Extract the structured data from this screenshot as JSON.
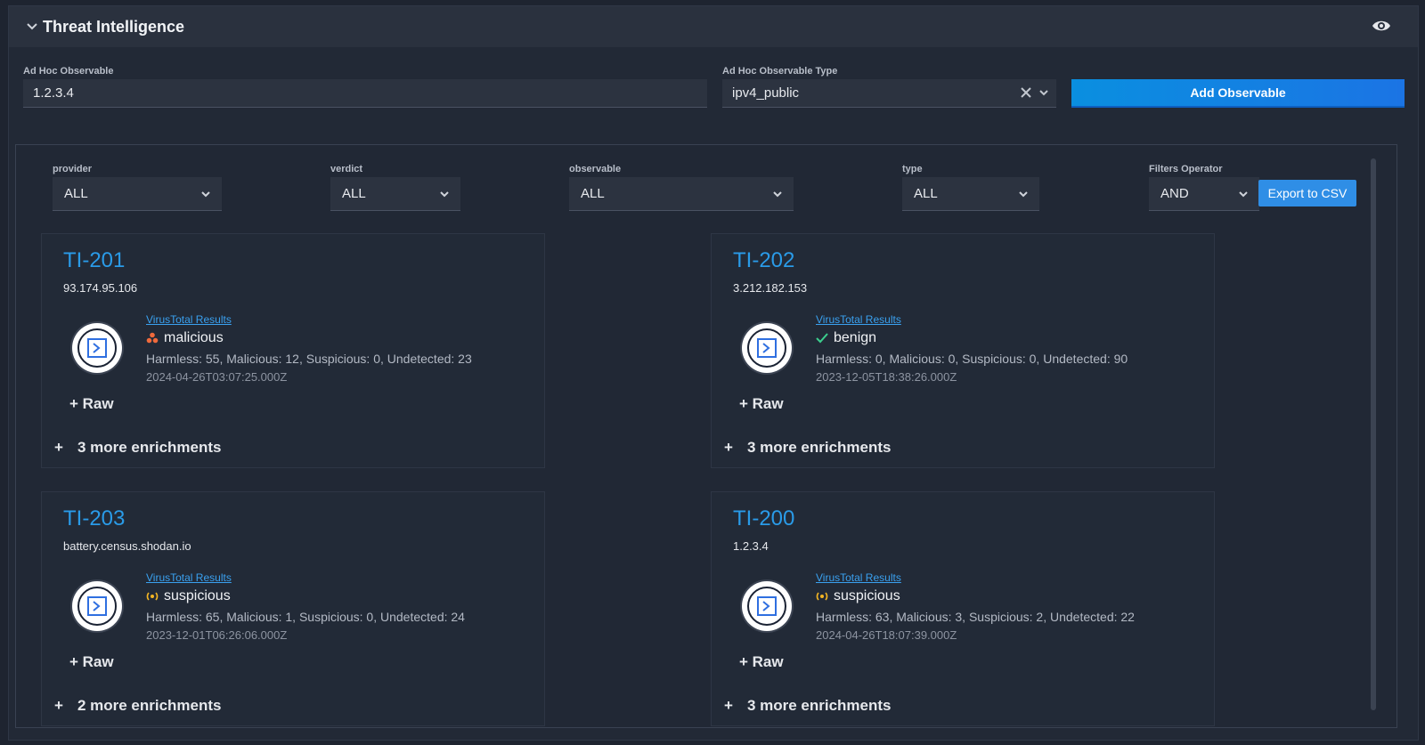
{
  "panel": {
    "title": "Threat Intelligence",
    "icons": {
      "collapse": "chevron-down-icon",
      "visibility": "eye-icon"
    }
  },
  "adhoc": {
    "observable_label": "Ad Hoc Observable",
    "observable_value": "1.2.3.4",
    "type_label": "Ad Hoc Observable Type",
    "type_value": "ipv4_public",
    "add_button": "Add Observable"
  },
  "filters": {
    "provider": {
      "label": "provider",
      "value": "ALL"
    },
    "verdict": {
      "label": "verdict",
      "value": "ALL"
    },
    "observable": {
      "label": "observable",
      "value": "ALL"
    },
    "type": {
      "label": "type",
      "value": "ALL"
    },
    "operator": {
      "label": "Filters Operator",
      "value": "AND"
    },
    "export_button": "Export to CSV"
  },
  "cards": [
    {
      "id": "TI-201",
      "observable": "93.174.95.106",
      "provider_link": "VirusTotal Results",
      "verdict": "malicious",
      "verdict_color": "#f06a3c",
      "stats": "Harmless: 55, Malicious: 12, Suspicious: 0, Undetected: 23",
      "date": "2024-04-26T03:07:25.000Z",
      "raw": "+ Raw",
      "more": "3 more enrichments"
    },
    {
      "id": "TI-202",
      "observable": "3.212.182.153",
      "provider_link": "VirusTotal Results",
      "verdict": "benign",
      "verdict_color": "#3ccf8e",
      "stats": "Harmless: 0, Malicious: 0, Suspicious: 0, Undetected: 90",
      "date": "2023-12-05T18:38:26.000Z",
      "raw": "+ Raw",
      "more": "3 more enrichments"
    },
    {
      "id": "TI-203",
      "observable": "battery.census.shodan.io",
      "provider_link": "VirusTotal Results",
      "verdict": "suspicious",
      "verdict_color": "#f5b623",
      "stats": "Harmless: 65, Malicious: 1, Suspicious: 0, Undetected: 24",
      "date": "2023-12-01T06:26:06.000Z",
      "raw": "+ Raw",
      "more": "2 more enrichments"
    },
    {
      "id": "TI-200",
      "observable": "1.2.3.4",
      "provider_link": "VirusTotal Results",
      "verdict": "suspicious",
      "verdict_color": "#f5b623",
      "stats": "Harmless: 63, Malicious: 3, Suspicious: 2, Undetected: 22",
      "date": "2024-04-26T18:07:39.000Z",
      "raw": "+ Raw",
      "more": "3 more enrichments"
    }
  ],
  "colors": {
    "accent": "#2a9be8",
    "button": "#1b74e4"
  }
}
